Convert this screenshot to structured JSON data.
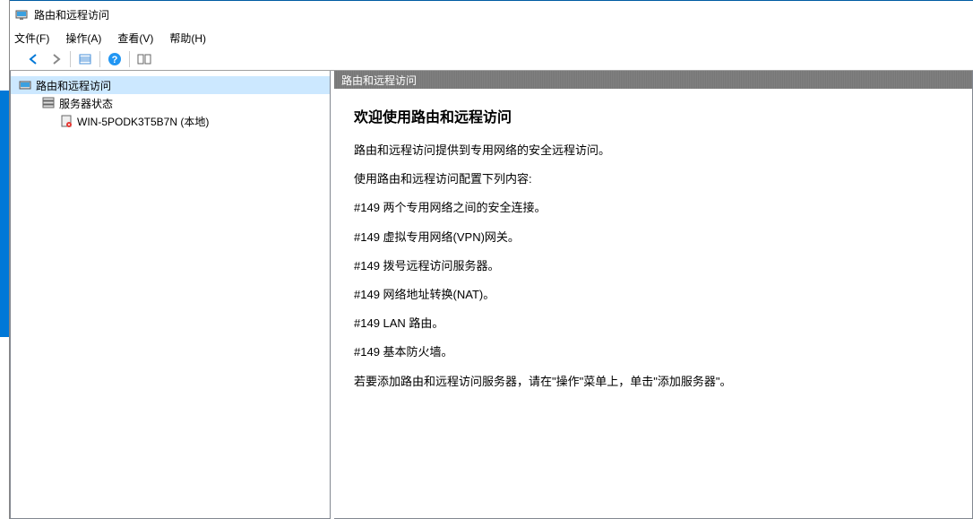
{
  "window": {
    "title": "路由和远程访问"
  },
  "menu": {
    "file": "文件(F)",
    "action": "操作(A)",
    "view": "查看(V)",
    "help": "帮助(H)"
  },
  "tree": {
    "root": "路由和远程访问",
    "server_status": "服务器状态",
    "local_server": "WIN-5PODK3T5B7N (本地)"
  },
  "main": {
    "header": "路由和远程访问",
    "welcome": "欢迎使用路由和远程访问",
    "intro": "路由和远程访问提供到专用网络的安全远程访问。",
    "config_label": "使用路由和远程访问配置下列内容:",
    "item1": "#149 两个专用网络之间的安全连接。",
    "item2": "#149 虚拟专用网络(VPN)网关。",
    "item3": "#149 拨号远程访问服务器。",
    "item4": "#149 网络地址转换(NAT)。",
    "item5": "#149 LAN 路由。",
    "item6": "#149 基本防火墙。",
    "instruction": "若要添加路由和远程访问服务器，请在\"操作\"菜单上，单击\"添加服务器\"。"
  }
}
